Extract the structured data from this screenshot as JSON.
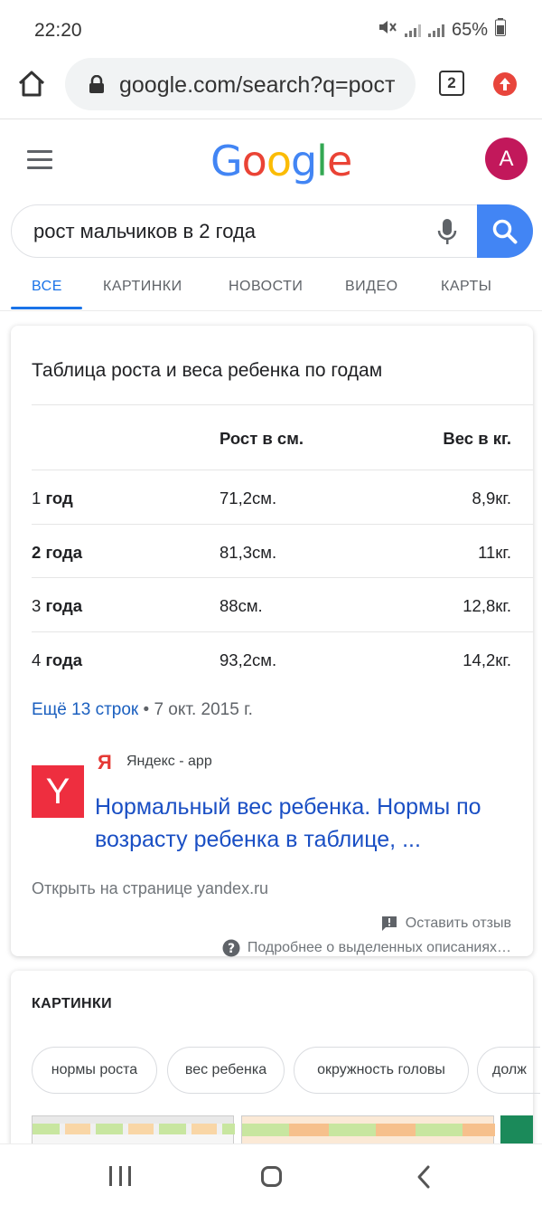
{
  "status_bar": {
    "time": "22:20",
    "battery": "65%"
  },
  "browser": {
    "url": "google.com/search?q=рост",
    "tab_count": "2"
  },
  "google": {
    "logo": "Google",
    "avatar_letter": "A"
  },
  "search": {
    "query": "рост мальчиков в 2 года"
  },
  "tabs": [
    "ВСЕ",
    "КАРТИНКИ",
    "НОВОСТИ",
    "ВИДЕО",
    "КАРТЫ"
  ],
  "snippet": {
    "title": "Таблица роста и веса ребенка по годам",
    "headers": {
      "height": "Рост в см.",
      "weight": "Вес в кг."
    },
    "rows": [
      {
        "num": "1",
        "unit": "год",
        "bold_num": false,
        "height": "71,2см.",
        "weight": "8,9кг."
      },
      {
        "num": "2",
        "unit": "года",
        "bold_num": true,
        "height": "81,3см.",
        "weight": "11кг."
      },
      {
        "num": "3",
        "unit": "года",
        "bold_num": false,
        "height": "88см.",
        "weight": "12,8кг."
      },
      {
        "num": "4",
        "unit": "года",
        "bold_num": false,
        "height": "93,2см.",
        "weight": "14,2кг."
      }
    ],
    "more_link": "Ещё 13 строк",
    "date": "7 окт. 2015 г.",
    "source_icon_letter": "Я",
    "source_thumb_letter": "Y",
    "source_name": "Яндекс - app",
    "result_title": "Нормальный вес ребенка. Нормы по возрасту ребенка в таблице, ...",
    "open_on_page": "Открыть на странице yandex.ru",
    "feedback": "Оставить отзыв",
    "about": "Подробнее о выделенных описаниях…"
  },
  "images": {
    "heading": "КАРТИНКИ",
    "chips": [
      "нормы роста",
      "вес ребенка",
      "окружность головы",
      "долж"
    ]
  },
  "colors": {
    "accent": "#1a73e8",
    "link": "#1a4fc4",
    "search_button": "#4285f4",
    "avatar": "#c2185b",
    "yandex": "#ee2e3f"
  }
}
